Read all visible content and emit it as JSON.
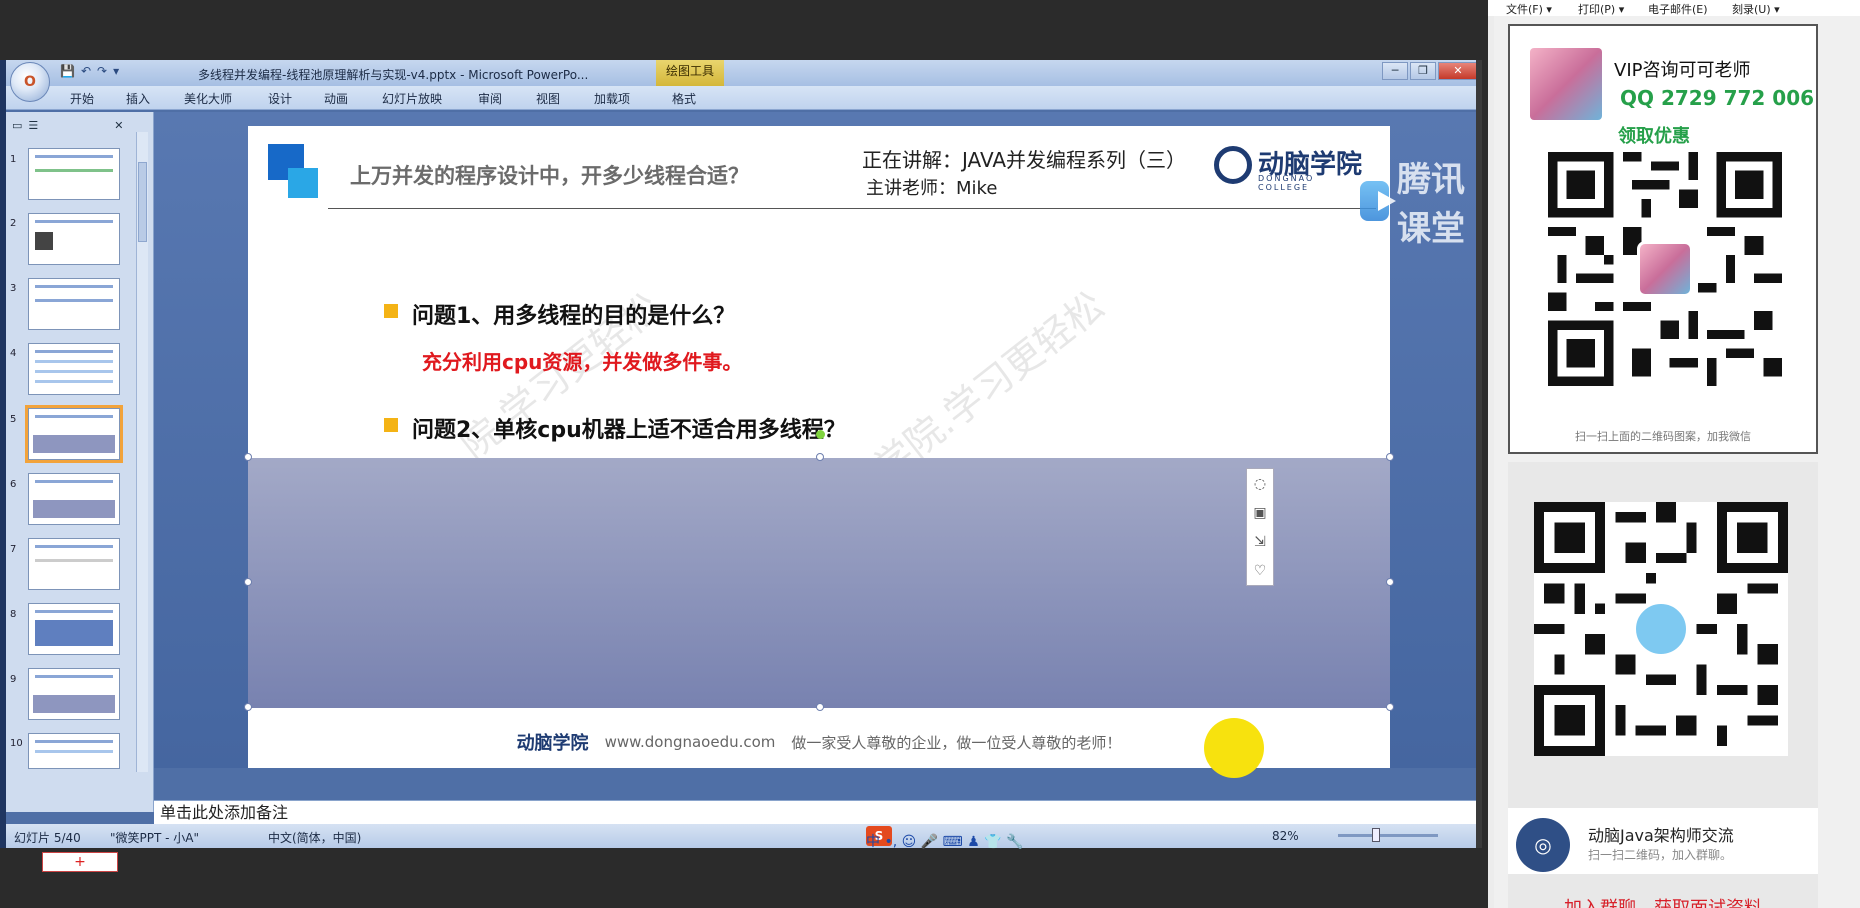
{
  "ppt": {
    "window_title": "多线程并发编程-线程池原理解析与实现-v4.pptx - Microsoft PowerPo...",
    "context_tab": "绘图工具",
    "office_button": "O",
    "quick_access": [
      "💾",
      "↶",
      "↷",
      "▾"
    ],
    "window_controls": [
      "─",
      "❐",
      "✕"
    ],
    "ribbon_tabs": [
      "开始",
      "插入",
      "美化大师",
      "设计",
      "动画",
      "幻灯片放映",
      "审阅",
      "视图",
      "加载项",
      "格式"
    ],
    "thumb_panel_tabs": [
      "▭",
      "☰",
      "✕"
    ],
    "thumb_numbers": [
      "1",
      "2",
      "3",
      "4",
      "5",
      "6",
      "7",
      "8",
      "9",
      "10"
    ],
    "selected_thumb": "5",
    "add_slide": "+",
    "slide": {
      "title": "上万并发的程序设计中，开多少线程合适？",
      "now_lecturing": "正在讲解：JAVA并发编程系列（三）",
      "teacher": "主讲老师：Mike",
      "brand_name": "动脑学院",
      "brand_sub": "DONGNAO COLLEGE",
      "q1": "问题1、用多线程的目的是什么？",
      "answer1": "充分利用cpu资源，并发做多件事。",
      "q2": "问题2、单核cpu机器上适不适合用多线程？",
      "watermark1": "院.学习更轻松",
      "watermark2": "学院.学习更轻松",
      "footer_brand": "动脑学院",
      "footer_url": "www.dongnaoedu.com",
      "footer_slogan": "做一家受人尊敬的企业，做一位受人尊敬的老师！"
    },
    "side_tools": [
      "◌",
      "▣",
      "⇲",
      "♡"
    ],
    "tencent_classroom": "腾讯课堂",
    "notes_placeholder": "单击此处添加备注",
    "status": {
      "slide_count": "幻灯片 5/40",
      "theme": "\"微笑PPT - 小A\"",
      "language": "中文(简体，中国)",
      "zoom": "82%",
      "ime_label": "S",
      "ime_chars": "中 •, ☺ 🎤 ⌨ ♟ 👕 🔧"
    }
  },
  "right_panel": {
    "menu": [
      "文件(F) ▾",
      "打印(P) ▾",
      "电子邮件(E)",
      "刻录(U) ▾"
    ],
    "vip_title": "VIP咨询可可老师",
    "qq": "QQ 2729 772 006",
    "promo": "领取优惠",
    "scan_tip": "扫一扫上面的二维码图案，加我微信",
    "group_name": "动脑Java架构师交流",
    "group_tip": "扫一扫二维码，加入群聊。",
    "join_text": "加入群聊，获取面试资料"
  }
}
